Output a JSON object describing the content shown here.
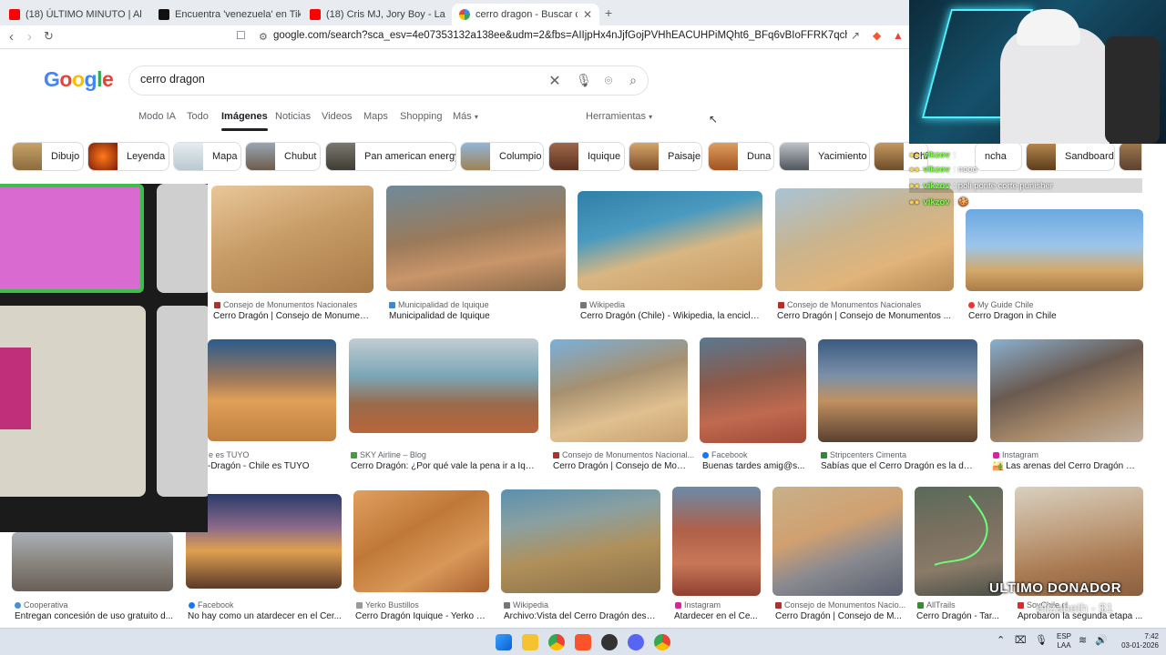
{
  "browser": {
    "tabs": [
      {
        "label": "(18) ÚLTIMO MINUTO | Al"
      },
      {
        "label": "Encuentra 'venezuela' en TikTok | Bus"
      },
      {
        "label": "(18) Cris MJ, Jory Boy - La Suburban"
      },
      {
        "label": "cerro dragon - Buscar con Goog"
      }
    ],
    "url": "google.com/search?sca_esv=4e07353132a138ee&udm=2&fbs=AIIjpHx4nJjfGojPVHhEACUHPiMQht6_BFq6vBIoFFRK7qchKHDX9TtpZ992kyQpCWcw0..."
  },
  "google": {
    "logo": "Google",
    "query": "cerro dragon",
    "tabs": [
      "Modo IA",
      "Todo",
      "Imágenes",
      "Noticias",
      "Videos",
      "Maps",
      "Shopping",
      "Más"
    ],
    "tools": "Herramientas"
  },
  "chips": [
    "Dibujo",
    "Leyenda",
    "Mapa",
    "Chubut",
    "Pan american energy",
    "Columpio",
    "Iquique",
    "Paisaje",
    "Duna",
    "Yacimiento",
    "Chile",
    "ncha",
    "Sandboard"
  ],
  "results": {
    "row1": [
      {
        "source": "Consejo de Monumentos Nacionales",
        "title": "Cerro Dragón | Consejo de Monument..."
      },
      {
        "source": "Municipalidad de Iquique",
        "title": "Municipalidad de Iquique"
      },
      {
        "source": "Wikipedia",
        "title": "Cerro Dragón (Chile) - Wikipedia, la enciclo..."
      },
      {
        "source": "Consejo de Monumentos Nacionales",
        "title": "Cerro Dragón | Consejo de Monumentos ..."
      },
      {
        "source": "My Guide Chile",
        "title": "Cerro Dragon in Chile"
      }
    ],
    "row2": [
      {
        "source": "e es TUYO",
        "title": "-Dragón - Chile es TUYO"
      },
      {
        "source": "SKY Airline – Blog",
        "title": "Cerro Dragón: ¿Por qué vale la pena ir a Iqui..."
      },
      {
        "source": "Consejo de Monumentos Nacional...",
        "title": "Cerro Dragón | Consejo de Mon..."
      },
      {
        "source": "Facebook",
        "title": "Buenas tardes amig@s..."
      },
      {
        "source": "Stripcenters Cimenta",
        "title": "Sabías que el Cerro Dragón es la du..."
      },
      {
        "source": "Instagram",
        "title": "🏜️ Las arenas del Cerro Dragón 🏂 ..."
      }
    ],
    "row3": [
      {
        "source": "Cooperativa",
        "title": "Entregan concesión de uso gratuito d..."
      },
      {
        "source": "Facebook",
        "title": "No hay como un atardecer en el Cer..."
      },
      {
        "source": "Yerko Bustillos",
        "title": "Cerro Dragón Iquique - Yerko B..."
      },
      {
        "source": "Wikipedia",
        "title": "Archivo:Vista del Cerro Dragón desd..."
      },
      {
        "source": "Instagram",
        "title": "Atardecer en el Ce..."
      },
      {
        "source": "Consejo de Monumentos Nacio...",
        "title": "Cerro Dragón | Consejo de M..."
      },
      {
        "source": "AllTrails",
        "title": "Cerro Dragón - Tar..."
      },
      {
        "source": "SoyChile.cl",
        "title": "Aprobaron la segunda etapa ..."
      }
    ]
  },
  "overlay": {
    "chat": [
      {
        "user": "vikzov",
        "msg": ": "
      },
      {
        "user": "vikzov",
        "msg": ": nooo"
      },
      {
        "user": "vikzov",
        "msg": ": poli ponte corte punisher"
      },
      {
        "user": "vikzov",
        "msg": ": 🍪"
      }
    ],
    "donor_title": "ULTIMO DONADOR",
    "donor_value": "elizabeth - $1"
  },
  "taskbar": {
    "lang_top": "ESP",
    "lang_bottom": "LAA",
    "time": "7:42",
    "date": "03-01-2026"
  }
}
